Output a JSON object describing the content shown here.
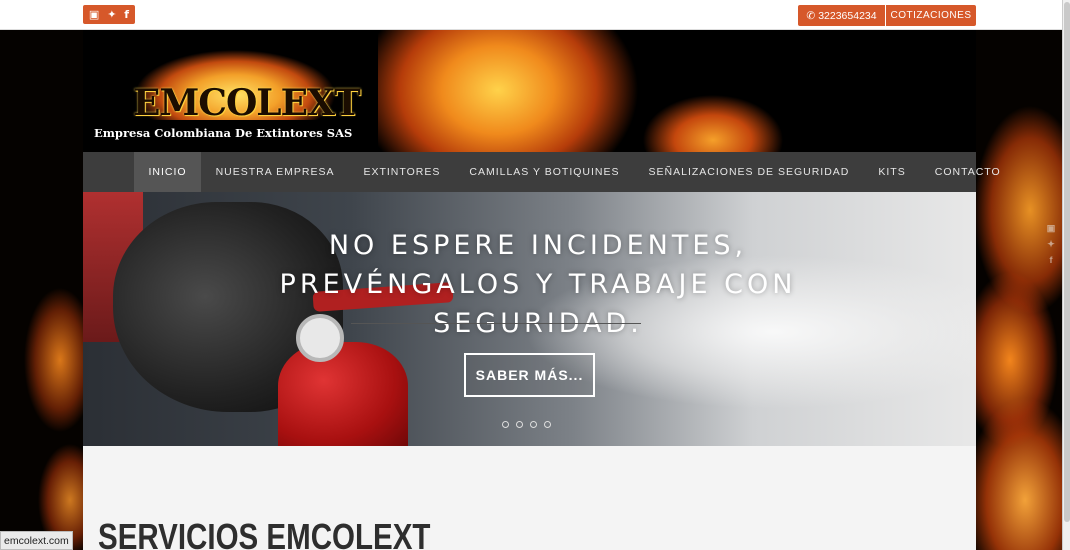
{
  "topbar": {
    "social_icons": [
      "youtube-icon",
      "twitter-icon",
      "facebook-icon"
    ],
    "youtube_glyph": "▣",
    "twitter_glyph": "✦",
    "facebook_glyph": "f",
    "phone_glyph": "✆",
    "phone": "3223654234",
    "quote_label": "COTIZACIONES"
  },
  "header": {
    "logo_text": "EMCOLEXT",
    "logo_subtitle": "Empresa Colombiana De Extintores SAS"
  },
  "nav": {
    "items": [
      {
        "label": "INICIO",
        "active": true
      },
      {
        "label": "NUESTRA EMPRESA"
      },
      {
        "label": "EXTINTORES"
      },
      {
        "label": "CAMILLAS Y BOTIQUINES"
      },
      {
        "label": "SEÑALIZACIONES DE SEGURIDAD"
      },
      {
        "label": "KITS"
      },
      {
        "label": "CONTACTO"
      }
    ]
  },
  "hero": {
    "title": "NO ESPERE INCIDENTES, PREVÉNGALOS Y TRABAJE CON SEGURIDAD.",
    "button_label": "SABER MÁS...",
    "slide_count": 4
  },
  "content": {
    "section_title": "SERVICIOS EMCOLEXT"
  },
  "side_social": {
    "youtube_glyph": "▣",
    "twitter_glyph": "✦",
    "facebook_glyph": "f"
  },
  "status_bar": {
    "url": "emcolext.com"
  },
  "colors": {
    "accent": "#d6582a",
    "nav_bg": "#3d3d3d",
    "nav_active": "#555555"
  }
}
